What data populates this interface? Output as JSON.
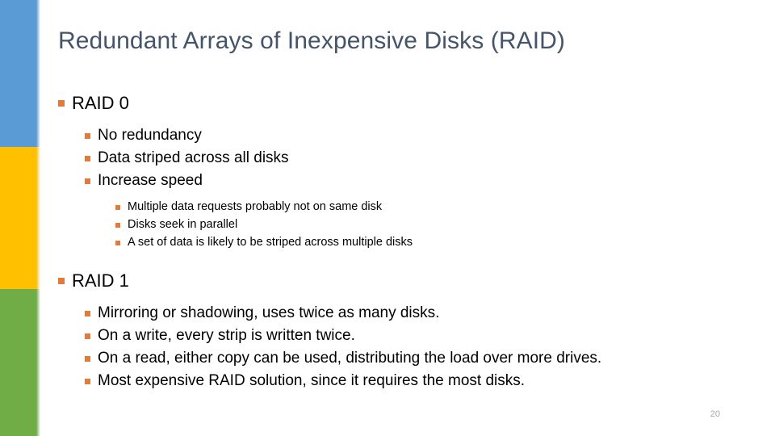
{
  "slide": {
    "title": "Redundant Arrays of Inexpensive Disks (RAID)",
    "page_number": "20",
    "colors": {
      "title_text": "#44546A",
      "body_text": "#000000",
      "bullet_marker": "#E07B39",
      "sidebar_blue": "#5B9BD5",
      "sidebar_yellow": "#FFC000",
      "sidebar_green": "#70AD47",
      "page_number_text": "#A6A6A6",
      "background": "#FFFFFF"
    }
  },
  "sidebar": {
    "segments": [
      {
        "name": "blue-segment",
        "color": "#5B9BD5"
      },
      {
        "name": "yellow-segment",
        "color": "#FFC000"
      },
      {
        "name": "green-segment",
        "color": "#70AD47"
      }
    ]
  },
  "content": {
    "raid0": {
      "heading": "RAID 0",
      "points": [
        "No redundancy",
        "Data striped across all disks",
        "Increase speed"
      ],
      "subpoints": [
        "Multiple data requests probably not on same disk",
        "Disks seek in parallel",
        "A set of data is likely to be striped across multiple disks"
      ]
    },
    "raid1": {
      "heading": "RAID 1",
      "points": [
        "Mirroring or shadowing, uses twice as many disks.",
        "On a write, every strip is written twice.",
        "On a read, either copy can be used, distributing the load over more drives.",
        "Most expensive RAID solution, since it requires the most disks."
      ]
    }
  }
}
